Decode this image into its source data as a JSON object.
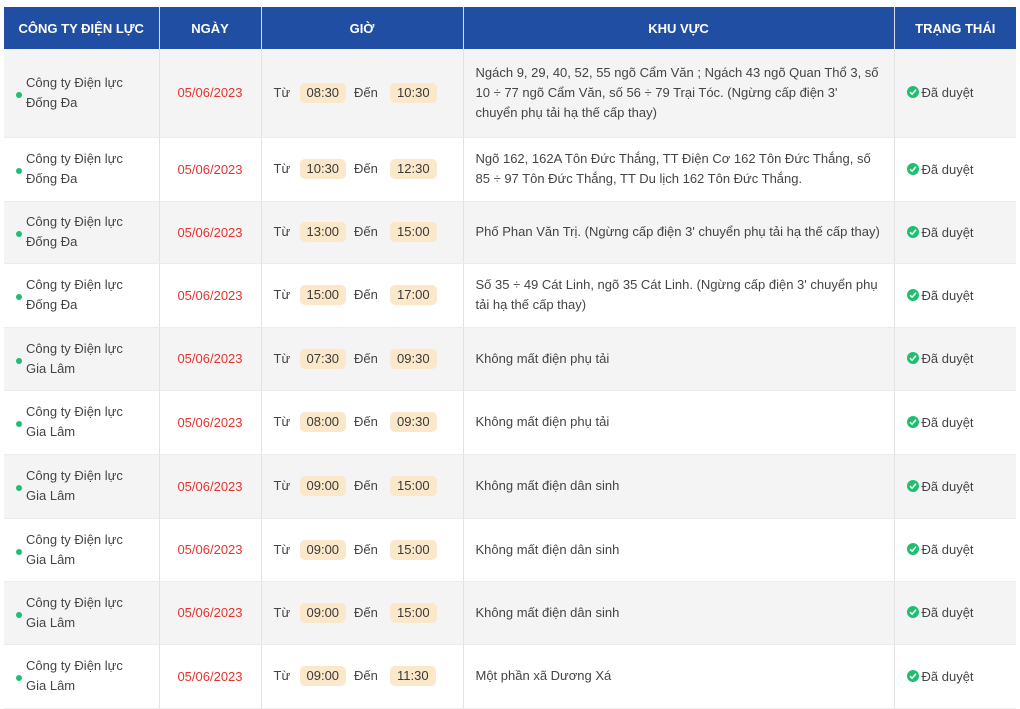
{
  "headers": {
    "company": "CÔNG TY ĐIỆN LỰC",
    "date": "NGÀY",
    "time": "GIỜ",
    "area": "KHU VỰC",
    "status": "TRẠNG THÁI"
  },
  "colors": {
    "header_bg": "#1f4ea3",
    "date_text": "#e3342f",
    "time_badge_bg": "#fbe7c9",
    "status_green": "#1fbf72"
  },
  "rows": [
    {
      "company": "Công ty Điện lực Đống Đa",
      "date": "05/06/2023",
      "from_label": "Từ",
      "from": "08:30",
      "to_label": "Đến",
      "to": "10:30",
      "area": "Ngách 9, 29, 40, 52, 55 ngõ Cẩm Văn ; Ngách 43 ngõ Quan Thổ 3, số 10 ÷ 77 ngõ Cẩm Văn, số 56 ÷ 79 Trại Tóc. (Ngừng cấp điện 3' chuyển phụ tải hạ thế cấp thay)",
      "status": "Đã duyệt"
    },
    {
      "company": "Công ty Điện lực Đống Đa",
      "date": "05/06/2023",
      "from_label": "Từ",
      "from": "10:30",
      "to_label": "Đến",
      "to": "12:30",
      "area": "Ngõ 162, 162A Tôn Đức Thắng, TT Điện Cơ 162 Tôn Đức Thắng, số 85 ÷ 97 Tôn Đức Thắng, TT Du lịch 162 Tôn Đức Thắng.",
      "status": "Đã duyệt"
    },
    {
      "company": "Công ty Điện lực Đống Đa",
      "date": "05/06/2023",
      "from_label": "Từ",
      "from": "13:00",
      "to_label": "Đến",
      "to": "15:00",
      "area": "Phố Phan Văn Trị. (Ngừng cấp điện 3' chuyển phụ tải hạ thế cấp thay)",
      "status": "Đã duyệt"
    },
    {
      "company": "Công ty Điện lực Đống Đa",
      "date": "05/06/2023",
      "from_label": "Từ",
      "from": "15:00",
      "to_label": "Đến",
      "to": "17:00",
      "area": "Số 35 ÷ 49 Cát Linh, ngõ 35 Cát Linh. (Ngừng cấp điện 3' chuyển phụ tải hạ thế cấp thay)",
      "status": "Đã duyệt"
    },
    {
      "company": "Công ty Điện lực Gia Lâm",
      "date": "05/06/2023",
      "from_label": "Từ",
      "from": "07:30",
      "to_label": "Đến",
      "to": "09:30",
      "area": "Không mất điện phụ tải",
      "status": "Đã duyệt"
    },
    {
      "company": "Công ty Điện lực Gia Lâm",
      "date": "05/06/2023",
      "from_label": "Từ",
      "from": "08:00",
      "to_label": "Đến",
      "to": "09:30",
      "area": "Không mất điện phụ tải",
      "status": "Đã duyệt"
    },
    {
      "company": "Công ty Điện lực Gia Lâm",
      "date": "05/06/2023",
      "from_label": "Từ",
      "from": "09:00",
      "to_label": "Đến",
      "to": "15:00",
      "area": "Không mất điện dân sinh",
      "status": "Đã duyệt"
    },
    {
      "company": "Công ty Điện lực Gia Lâm",
      "date": "05/06/2023",
      "from_label": "Từ",
      "from": "09:00",
      "to_label": "Đến",
      "to": "15:00",
      "area": "Không mất điện dân sinh",
      "status": "Đã duyệt"
    },
    {
      "company": "Công ty Điện lực Gia Lâm",
      "date": "05/06/2023",
      "from_label": "Từ",
      "from": "09:00",
      "to_label": "Đến",
      "to": "15:00",
      "area": "Không mất điện dân sinh",
      "status": "Đã duyệt"
    },
    {
      "company": "Công ty Điện lực Gia Lâm",
      "date": "05/06/2023",
      "from_label": "Từ",
      "from": "09:00",
      "to_label": "Đến",
      "to": "11:30",
      "area": "Một phần xã Dương Xá",
      "status": "Đã duyệt"
    }
  ]
}
